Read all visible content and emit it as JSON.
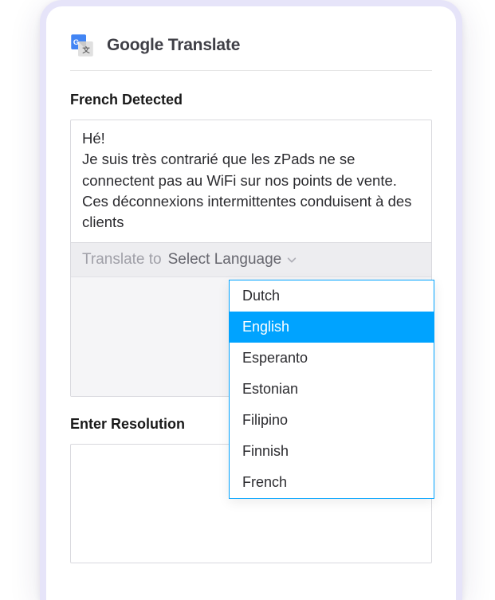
{
  "header": {
    "title": "Google Translate"
  },
  "detected": {
    "label": "French Detected",
    "source_text": "Hé!\nJe suis très contrarié que les zPads ne se connectent pas au WiFi sur nos points de vente. Ces déconnexions intermittentes conduisent à des clients"
  },
  "translate_bar": {
    "label": "Translate to",
    "selected": "Select Language"
  },
  "dropdown": {
    "options": [
      {
        "label": "Dutch",
        "highlight": false
      },
      {
        "label": "English",
        "highlight": true
      },
      {
        "label": "Esperanto",
        "highlight": false
      },
      {
        "label": "Estonian",
        "highlight": false
      },
      {
        "label": "Filipino",
        "highlight": false
      },
      {
        "label": "Finnish",
        "highlight": false
      },
      {
        "label": "French",
        "highlight": false
      }
    ]
  },
  "resolution": {
    "label": "Enter Resolution"
  }
}
